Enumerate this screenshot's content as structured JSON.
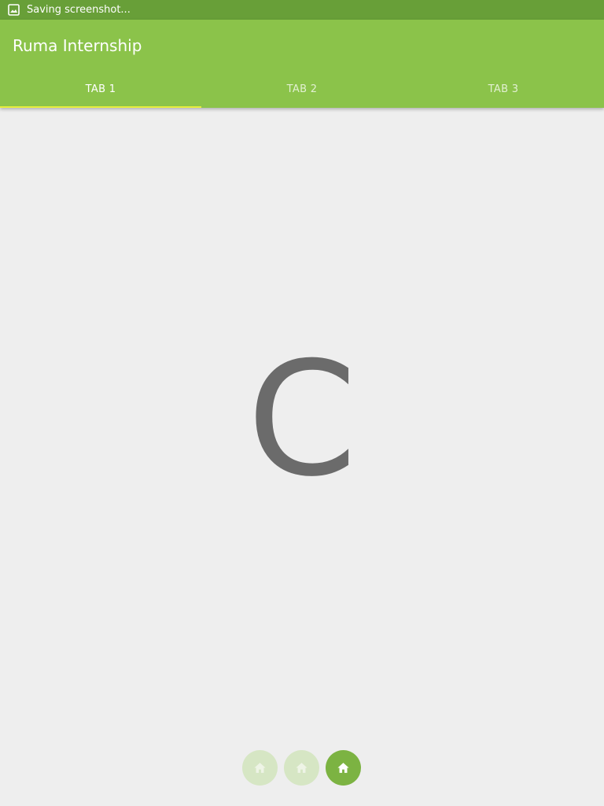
{
  "status_bar": {
    "notification_icon": "image-icon",
    "text": "Saving screenshot..."
  },
  "app_bar": {
    "title": "Ruma Internship",
    "tabs": [
      {
        "label": "TAB 1",
        "active": true
      },
      {
        "label": "TAB 2",
        "active": false
      },
      {
        "label": "TAB 3",
        "active": false
      }
    ]
  },
  "content": {
    "letter": "C"
  },
  "page_indicator": {
    "icon": "home-icon",
    "pages": 3,
    "current_page": 3
  },
  "colors": {
    "status_bar": "#689f38",
    "primary": "#8bc34a",
    "tab_indicator": "#e6ee3c",
    "active_dot": "#7cb342",
    "inactive_dot": "#d6e6c4",
    "background": "#eeeeee"
  }
}
